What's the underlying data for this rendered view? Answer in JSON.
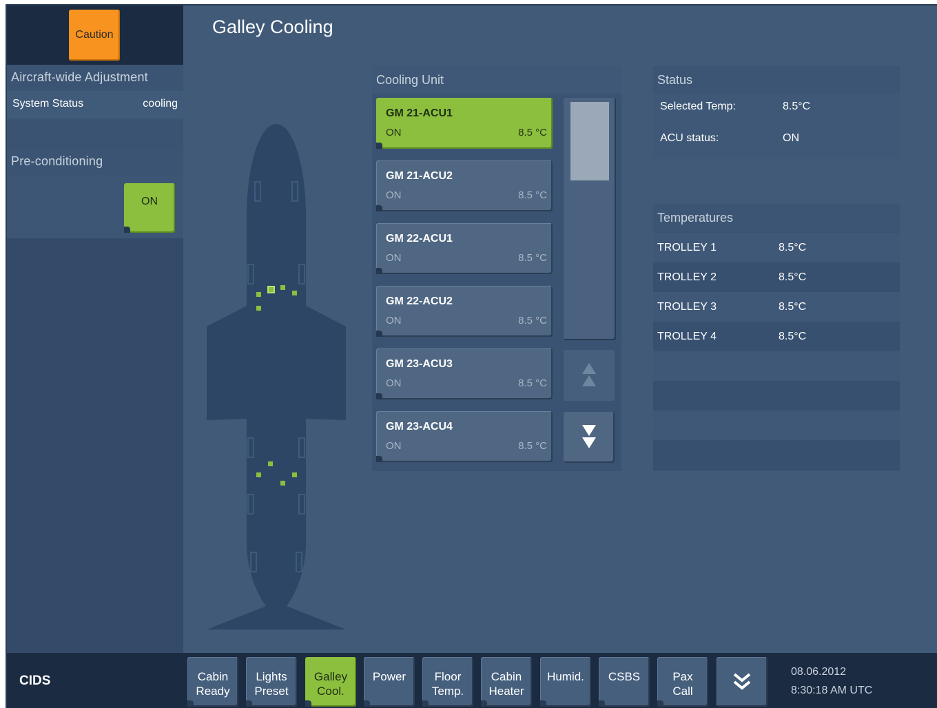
{
  "caution": {
    "label": "Caution"
  },
  "left": {
    "aircraft_heading": "Aircraft-wide Adjustment",
    "system_status_label": "System Status",
    "system_status_value": "cooling",
    "precond_heading": "Pre-conditioning",
    "precond_button": "ON"
  },
  "page": {
    "title": "Galley Cooling"
  },
  "cooling_unit": {
    "heading": "Cooling Unit",
    "units": [
      {
        "name": "GM 21-ACU1",
        "status": "ON",
        "temp": "8.5 °C"
      },
      {
        "name": "GM 21-ACU2",
        "status": "ON",
        "temp": "8.5 °C"
      },
      {
        "name": "GM 22-ACU1",
        "status": "ON",
        "temp": "8.5 °C"
      },
      {
        "name": "GM 22-ACU2",
        "status": "ON",
        "temp": "8.5 °C"
      },
      {
        "name": "GM 23-ACU3",
        "status": "ON",
        "temp": "8.5 °C"
      },
      {
        "name": "GM 23-ACU4",
        "status": "ON",
        "temp": "8.5 °C"
      }
    ]
  },
  "status": {
    "heading": "Status",
    "selected_temp_label": "Selected Temp:",
    "selected_temp_value": "8.5°C",
    "acu_status_label": "ACU status:",
    "acu_status_value": "ON"
  },
  "temperatures": {
    "heading": "Temperatures",
    "rows": [
      {
        "label": "TROLLEY 1",
        "value": "8.5°C"
      },
      {
        "label": "TROLLEY 2",
        "value": "8.5°C"
      },
      {
        "label": "TROLLEY 3",
        "value": "8.5°C"
      },
      {
        "label": "TROLLEY 4",
        "value": "8.5°C"
      }
    ]
  },
  "bottom": {
    "app_label": "CIDS",
    "nav": [
      "Cabin\nReady",
      "Lights\nPreset",
      "Galley\nCool.",
      "Power",
      "Floor\nTemp.",
      "Cabin\nHeater",
      "Humid.",
      "CSBS",
      "Pax\nCall"
    ],
    "active_nav": "Galley\nCool.",
    "date": "08.06.2012",
    "time": "8:30:18 AM UTC"
  },
  "colors": {
    "accent_green": "#8cbf3e",
    "caution_orange": "#f7931e",
    "panel_blue": "#415a78"
  },
  "icons": {
    "scroll_up": "double-chevron-up-icon",
    "scroll_down": "double-chevron-down-icon",
    "more": "double-chevron-down-icon"
  }
}
